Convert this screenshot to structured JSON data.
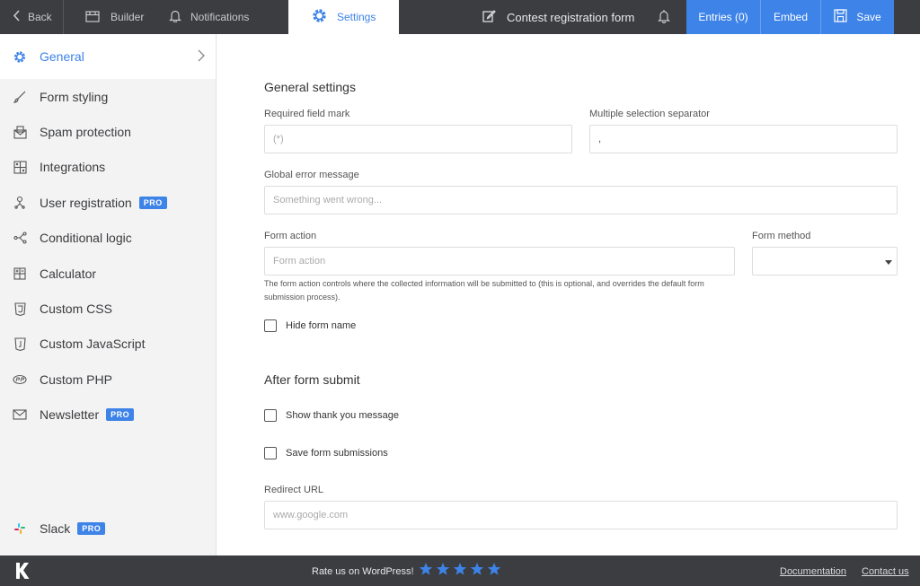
{
  "topbar": {
    "back_label": "Back",
    "builder_label": "Builder",
    "notifications_label": "Notifications",
    "settings_label": "Settings",
    "form_title": "Contest registration form",
    "entries_label": "Entries (0)",
    "embed_label": "Embed",
    "save_label": "Save"
  },
  "sidebar": {
    "items": [
      {
        "label": "General",
        "icon": "gear-icon",
        "active": true
      },
      {
        "label": "Form styling",
        "icon": "brush-icon"
      },
      {
        "label": "Spam protection",
        "icon": "spam-shield-icon"
      },
      {
        "label": "Integrations",
        "icon": "puzzle-icon"
      },
      {
        "label": "User registration",
        "icon": "user-tree-icon",
        "badge": "PRO"
      },
      {
        "label": "Conditional logic",
        "icon": "branch-icon"
      },
      {
        "label": "Calculator",
        "icon": "calculator-icon"
      },
      {
        "label": "Custom CSS",
        "icon": "css-icon"
      },
      {
        "label": "Custom JavaScript",
        "icon": "js-icon"
      },
      {
        "label": "Custom PHP",
        "icon": "php-icon"
      },
      {
        "label": "Newsletter",
        "icon": "envelope-icon",
        "badge": "PRO"
      }
    ],
    "slack": {
      "label": "Slack",
      "icon": "slack-icon",
      "badge": "PRO"
    }
  },
  "general": {
    "heading": "General settings",
    "required_mark_label": "Required field mark",
    "required_mark_placeholder": "(*)",
    "separator_label": "Multiple selection separator",
    "separator_value": ",",
    "error_label": "Global error message",
    "error_placeholder": "Something went wrong...",
    "action_label": "Form action",
    "action_placeholder": "Form action",
    "method_label": "Form method",
    "action_help": "The form action controls where the collected information will be submitted to (this is optional, and overrides the default form submission process).",
    "hide_name_label": "Hide form name"
  },
  "after_submit": {
    "heading": "After form submit",
    "thank_you_label": "Show thank you message",
    "save_submissions_label": "Save form submissions",
    "redirect_label": "Redirect URL",
    "redirect_placeholder": "www.google.com"
  },
  "footer": {
    "logo": "K",
    "rate_text": "Rate us on WordPress!",
    "stars": 5,
    "documentation_label": "Documentation",
    "contact_label": "Contact us"
  },
  "colors": {
    "accent": "#3d83e8",
    "topbar": "#3b3d40",
    "sidebar": "#f3f3f4"
  }
}
